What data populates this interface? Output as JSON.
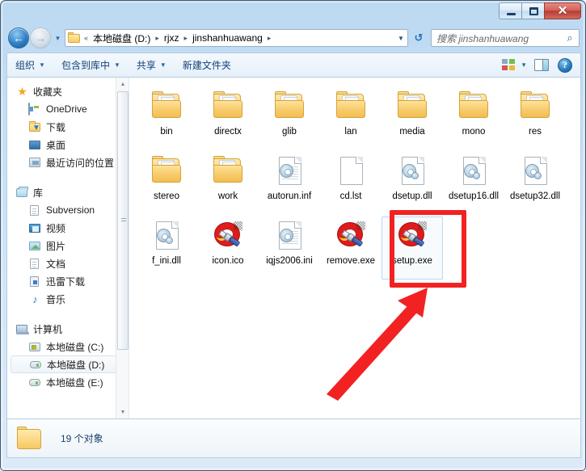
{
  "window": {
    "controls": {
      "minimize": "–",
      "maximize": "□",
      "close": "✕"
    }
  },
  "nav": {
    "back_icon": "←",
    "forward_icon": "→",
    "history_caret": "▼",
    "breadcrumb": {
      "leading": "«",
      "parts": [
        "本地磁盘 (D:)",
        "rjxz",
        "jinshanhuawang"
      ],
      "separator": "▸",
      "dropdown_caret": "▼"
    },
    "refresh_icon": "↺",
    "search": {
      "placeholder": "搜索 jinshanhuawang",
      "icon": "⌕"
    }
  },
  "toolbar": {
    "items": [
      {
        "label": "组织",
        "caret": "▼"
      },
      {
        "label": "包含到库中",
        "caret": "▼"
      },
      {
        "label": "共享",
        "caret": "▼"
      },
      {
        "label": "新建文件夹",
        "caret": ""
      }
    ],
    "view_caret": "▼",
    "help_label": "?"
  },
  "sidebar": {
    "groups": [
      {
        "head": {
          "label": "收藏夹",
          "icon": "star-icon"
        },
        "items": [
          {
            "label": "OneDrive",
            "icon": "onedrive-icon"
          },
          {
            "label": "下载",
            "icon": "downloads-icon"
          },
          {
            "label": "桌面",
            "icon": "desktop-icon"
          },
          {
            "label": "最近访问的位置",
            "icon": "recent-places-icon"
          }
        ]
      },
      {
        "head": {
          "label": "库",
          "icon": "library-icon"
        },
        "items": [
          {
            "label": "Subversion",
            "icon": "document-icon"
          },
          {
            "label": "视频",
            "icon": "video-icon"
          },
          {
            "label": "图片",
            "icon": "picture-icon"
          },
          {
            "label": "文档",
            "icon": "document-icon"
          },
          {
            "label": "迅雷下载",
            "icon": "thunder-download-icon"
          },
          {
            "label": "音乐",
            "icon": "music-icon"
          }
        ]
      },
      {
        "head": {
          "label": "计算机",
          "icon": "computer-icon"
        },
        "items": [
          {
            "label": "本地磁盘 (C:)",
            "icon": "drive-c-icon",
            "selected": false
          },
          {
            "label": "本地磁盘 (D:)",
            "icon": "drive-icon",
            "selected": true
          },
          {
            "label": "本地磁盘 (E:)",
            "icon": "drive-icon",
            "selected": false
          }
        ]
      }
    ],
    "scrollbar": {
      "up": "▲",
      "down": "▼"
    }
  },
  "files": [
    {
      "name": "bin",
      "type": "folder",
      "selected": false
    },
    {
      "name": "directx",
      "type": "folder",
      "selected": false
    },
    {
      "name": "glib",
      "type": "folder",
      "selected": false
    },
    {
      "name": "lan",
      "type": "folder",
      "selected": false
    },
    {
      "name": "media",
      "type": "folder",
      "selected": false
    },
    {
      "name": "mono",
      "type": "folder",
      "selected": false
    },
    {
      "name": "res",
      "type": "folder",
      "selected": false
    },
    {
      "name": "stereo",
      "type": "folder",
      "selected": false
    },
    {
      "name": "work",
      "type": "folder",
      "selected": false
    },
    {
      "name": "autorun.inf",
      "type": "config",
      "selected": false
    },
    {
      "name": "cd.lst",
      "type": "blank",
      "selected": false
    },
    {
      "name": "dsetup.dll",
      "type": "dll",
      "selected": false
    },
    {
      "name": "dsetup16.dll",
      "type": "dll",
      "selected": false
    },
    {
      "name": "dsetup32.dll",
      "type": "dll",
      "selected": false
    },
    {
      "name": "f_ini.dll",
      "type": "dll",
      "selected": false
    },
    {
      "name": "icon.ico",
      "type": "exe",
      "selected": false
    },
    {
      "name": "iqjs2006.ini",
      "type": "config",
      "selected": false
    },
    {
      "name": "remove.exe",
      "type": "exe",
      "selected": false
    },
    {
      "name": "setup.exe",
      "type": "exe",
      "selected": true
    }
  ],
  "status": {
    "text": "19 个对象"
  },
  "annotation": {
    "color": "#f22222",
    "target": "setup.exe"
  }
}
